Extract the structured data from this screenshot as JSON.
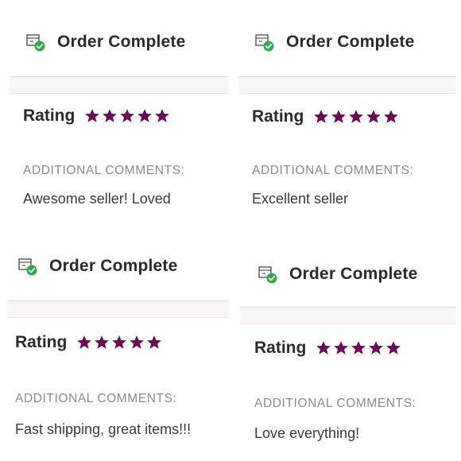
{
  "orders": [
    {
      "title": "Order Complete",
      "rating_label": "Rating",
      "stars": 5,
      "comments_label": "ADDITIONAL COMMENTS:",
      "comment": "Awesome seller! Loved"
    },
    {
      "title": "Order Complete",
      "rating_label": "Rating",
      "stars": 5,
      "comments_label": "ADDITIONAL COMMENTS:",
      "comment": "Excellent seller"
    },
    {
      "title": "Order Complete",
      "rating_label": "Rating",
      "stars": 5,
      "comments_label": "ADDITIONAL COMMENTS:",
      "comment": "Fast shipping, great items!!!"
    },
    {
      "title": "Order Complete",
      "rating_label": "Rating",
      "stars": 5,
      "comments_label": "ADDITIONAL COMMENTS:",
      "comment": "Love everything!"
    }
  ],
  "icons": {
    "order_status": "package-check-icon",
    "rating": "star-icon"
  },
  "colors": {
    "star": "#6e0a52",
    "check": "#2eaa4a"
  }
}
